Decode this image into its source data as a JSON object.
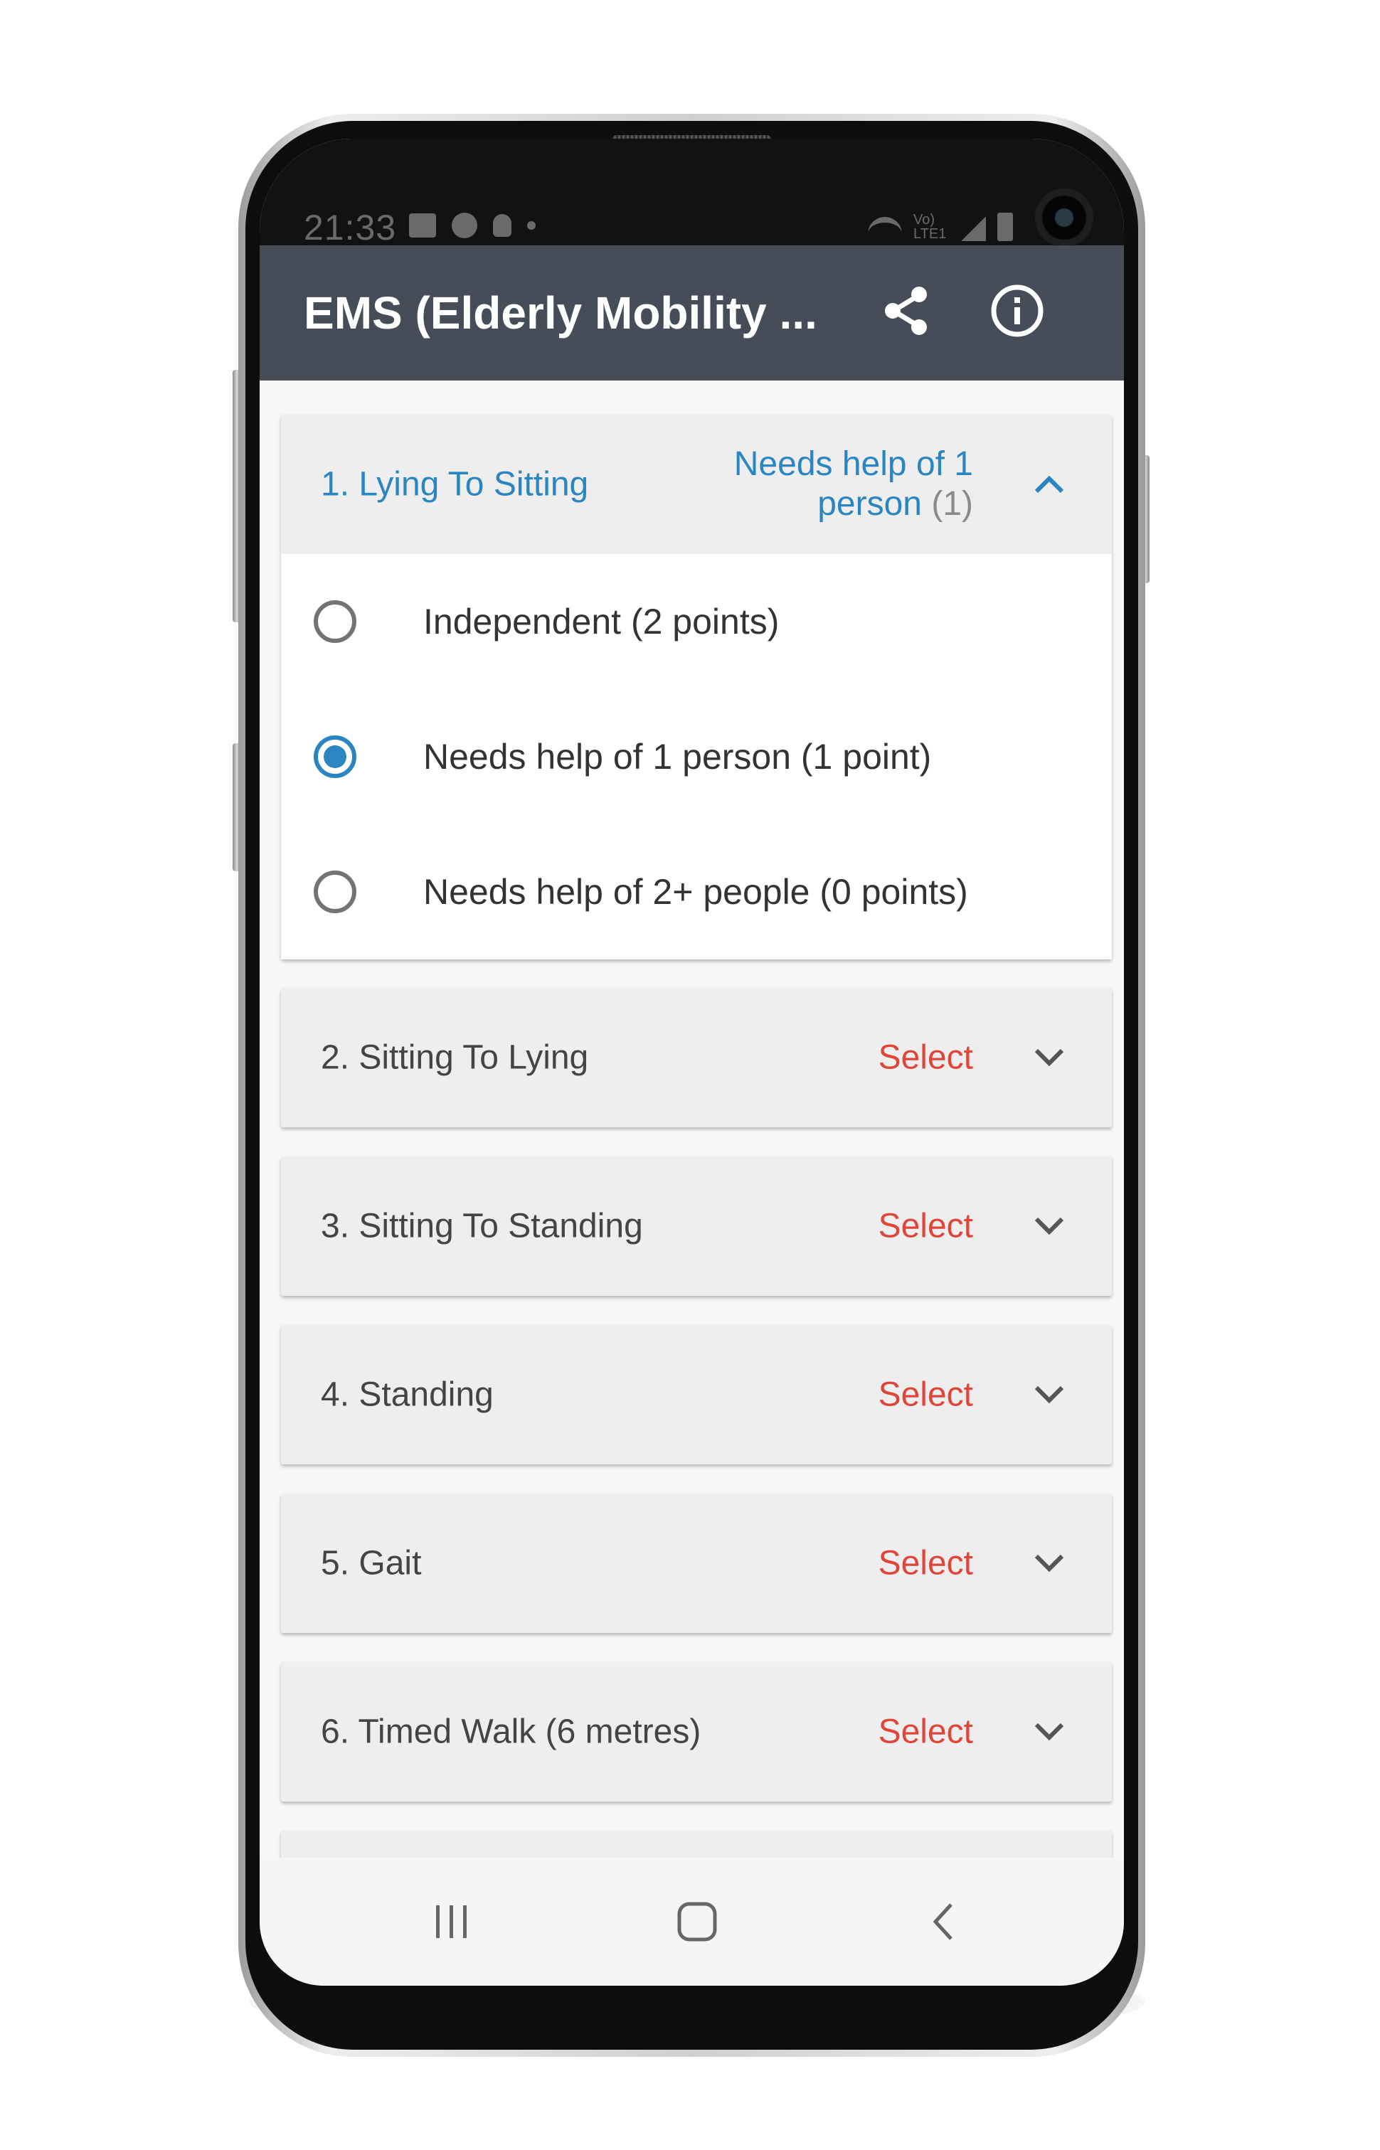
{
  "status_bar": {
    "time": "21:33",
    "volte_text": "Vo) LTE1"
  },
  "app_bar": {
    "title": "EMS (Elderly Mobility ..."
  },
  "sections": [
    {
      "title": "1. Lying To Sitting",
      "value": "Needs help of 1 person",
      "score": "(1)",
      "expanded": true,
      "options": [
        {
          "label": "Independent (2 points)",
          "selected": false
        },
        {
          "label": "Needs help of 1 person (1 point)",
          "selected": true
        },
        {
          "label": "Needs help of 2+ people (0 points)",
          "selected": false
        }
      ]
    },
    {
      "title": "2. Sitting To Lying",
      "value": "Select",
      "expanded": false
    },
    {
      "title": "3. Sitting To Standing",
      "value": "Select",
      "expanded": false
    },
    {
      "title": "4. Standing",
      "value": "Select",
      "expanded": false
    },
    {
      "title": "5. Gait",
      "value": "Select",
      "expanded": false
    },
    {
      "title": "6. Timed Walk (6 metres)",
      "value": "Select",
      "expanded": false
    }
  ],
  "icons": {
    "share": "share-icon",
    "info": "info-icon",
    "collapse": "chevron-up-icon",
    "expand": "chevron-down-icon",
    "recents": "recents-icon",
    "home": "home-icon",
    "back": "back-icon"
  },
  "colors": {
    "app_bar": "#464c58",
    "accent_blue": "#2a85c0",
    "select_red": "#e0453a",
    "card_bg": "#eeeeee"
  }
}
